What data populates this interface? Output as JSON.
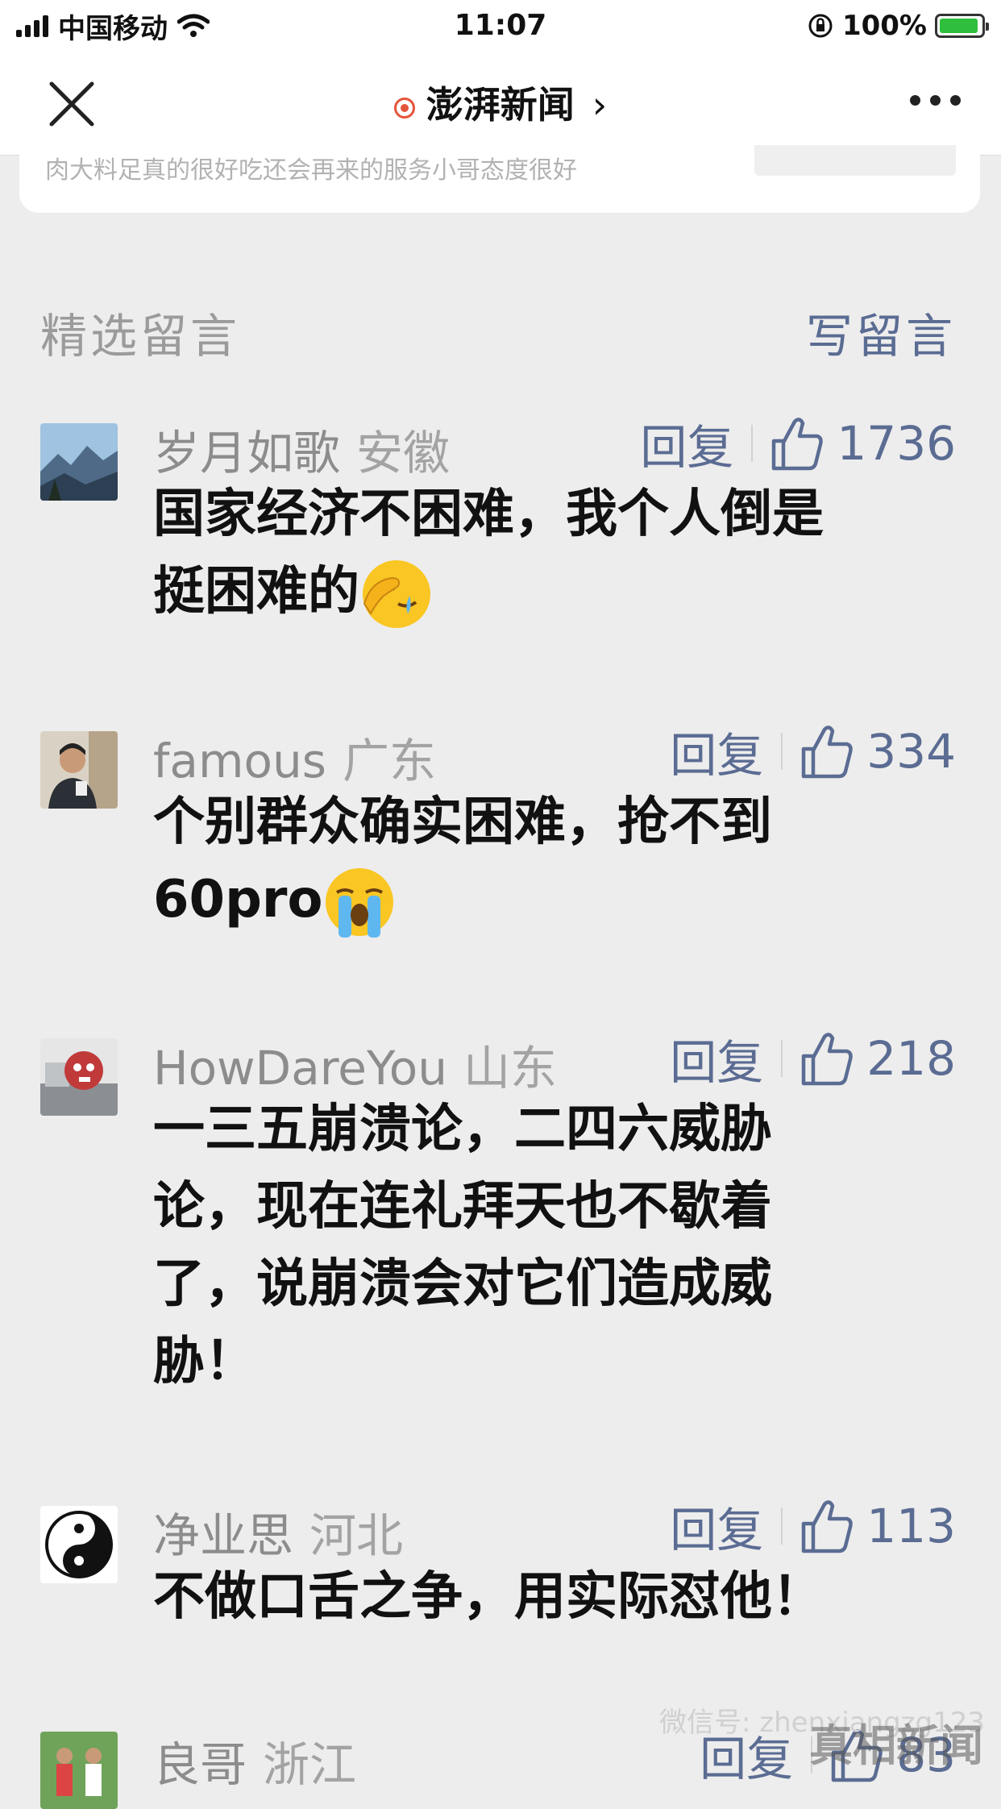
{
  "status_bar": {
    "carrier": "中国移动",
    "time": "11:07",
    "battery": "100%"
  },
  "nav": {
    "title": "澎湃新闻",
    "chevron": "›"
  },
  "card": {
    "text": "肉大料足真的很好吃还会再来的服务小哥态度很好"
  },
  "section": {
    "title": "精选留言",
    "write_label": "写留言"
  },
  "comments": [
    {
      "name": "岁月如歌",
      "location": "安徽",
      "reply_label": "回复",
      "likes": "1736",
      "line1": "国家经济不困难，我个人倒是",
      "line2": "挺困难的",
      "emoji": "facepalm-crying-emoji"
    },
    {
      "name": "famous",
      "location": "广东",
      "reply_label": "回复",
      "likes": "334",
      "line1": "个别群众确实困难，抢不到",
      "line2": "60pro",
      "emoji": "loudly-crying-emoji"
    },
    {
      "name": "HowDareYou",
      "location": "山东",
      "reply_label": "回复",
      "likes": "218",
      "line1": "一三五崩溃论，二四六威胁",
      "line2": "论，现在连礼拜天也不歇着",
      "line3": "了，说崩溃会对它们造成威",
      "line4": "胁！"
    },
    {
      "name": "净业思",
      "location": "河北",
      "reply_label": "回复",
      "likes": "113",
      "line1": "不做口舌之争，用实际怼他！"
    },
    {
      "name": "良哥",
      "location": "浙江",
      "reply_label": "回复",
      "likes": "83"
    }
  ],
  "watermark": {
    "text": "微信号: zhenxiangzg123",
    "brand": "真相新闻"
  }
}
